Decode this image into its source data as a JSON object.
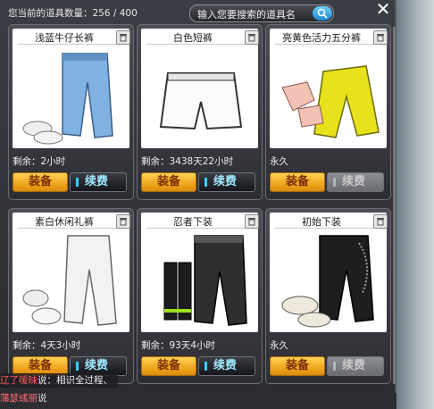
{
  "header": {
    "count_label": "您当前的道具数量：256 / 400",
    "search_placeholder": "输入您要搜索的道具名"
  },
  "buttons": {
    "equip": "装备",
    "renew": "续费"
  },
  "items": [
    {
      "name": "浅蓝牛仔长裤",
      "remaining": "剩余：2小时",
      "renew_enabled": true
    },
    {
      "name": "白色短裤",
      "remaining": "剩余：3438天22小时",
      "renew_enabled": true
    },
    {
      "name": "亮黄色活力五分裤",
      "remaining": "永久",
      "renew_enabled": false
    },
    {
      "name": "素白休闲礼裤",
      "remaining": "剩余：4天3小时",
      "renew_enabled": true
    },
    {
      "name": "忍者下装",
      "remaining": "剩余：93天4小时",
      "renew_enabled": true
    },
    {
      "name": "初始下装",
      "remaining": "永久",
      "renew_enabled": false
    }
  ],
  "chat": {
    "line1_name": "辽了嗳昧",
    "line1_text": "说：相识全过程、",
    "line2_name": "蒲瑟彧丽",
    "line2_text": "说"
  },
  "colors": {
    "equip": "#f2a51c",
    "renew_text": "#9fe7ff",
    "search_button": "#1f86c9"
  }
}
